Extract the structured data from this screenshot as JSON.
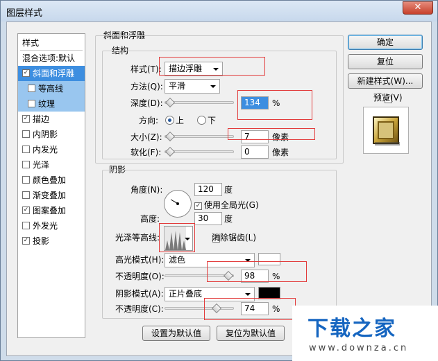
{
  "window": {
    "title": "图层样式",
    "close_label": "✕"
  },
  "left_list": {
    "header": "样式",
    "items": [
      {
        "label": "混合选项:默认",
        "check": ""
      },
      {
        "label": "斜面和浮雕",
        "check": "✓"
      },
      {
        "label": "等高线",
        "check": ""
      },
      {
        "label": "纹理",
        "check": ""
      },
      {
        "label": "描边",
        "check": "✓"
      },
      {
        "label": "内阴影",
        "check": ""
      },
      {
        "label": "内发光",
        "check": ""
      },
      {
        "label": "光泽",
        "check": ""
      },
      {
        "label": "颜色叠加",
        "check": ""
      },
      {
        "label": "渐变叠加",
        "check": ""
      },
      {
        "label": "图案叠加",
        "check": "✓"
      },
      {
        "label": "外发光",
        "check": ""
      },
      {
        "label": "投影",
        "check": "✓"
      }
    ]
  },
  "bevel": {
    "group_label": "斜面和浮雕",
    "structure_label": "结构",
    "style_label": "样式(T):",
    "style_value": "描边浮雕",
    "method_label": "方法(Q):",
    "method_value": "平滑",
    "depth_label": "深度(D):",
    "depth_value": "134",
    "depth_unit": "%",
    "direction_label": "方向:",
    "dir_up": "上",
    "dir_down": "下",
    "size_label": "大小(Z):",
    "size_value": "7",
    "size_unit": "像素",
    "soften_label": "软化(F):",
    "soften_value": "0",
    "soften_unit": "像素"
  },
  "shading": {
    "group_label": "阴影",
    "angle_label": "角度(N):",
    "angle_value": "120",
    "angle_unit": "度",
    "global_light_label": "使用全局光(G)",
    "altitude_label": "高度:",
    "altitude_value": "30",
    "altitude_unit": "度",
    "gloss_label": "光泽等高线:",
    "antialias_label": "消除锯齿(L)",
    "highlight_mode_label": "高光模式(H):",
    "highlight_mode_value": "滤色",
    "highlight_opacity_label": "不透明度(O):",
    "highlight_opacity_value": "98",
    "highlight_opacity_unit": "%",
    "highlight_color": "#ffffff",
    "shadow_mode_label": "阴影模式(A):",
    "shadow_mode_value": "正片叠底",
    "shadow_opacity_label": "不透明度(C):",
    "shadow_opacity_value": "74",
    "shadow_opacity_unit": "%",
    "shadow_color": "#000000"
  },
  "bottom_buttons": {
    "set_default": "设置为默认值",
    "reset_default": "复位为默认值"
  },
  "right_buttons": {
    "ok": "确定",
    "reset": "复位",
    "new_style": "新建样式(W)...",
    "preview": "预览(V)"
  },
  "watermark": {
    "brand": "下载之家",
    "url": "www.downza.cn"
  },
  "colors": {
    "selection": "#3d8ee0",
    "annotation": "#e23b3b",
    "watermark_blue": "#1565c0"
  }
}
